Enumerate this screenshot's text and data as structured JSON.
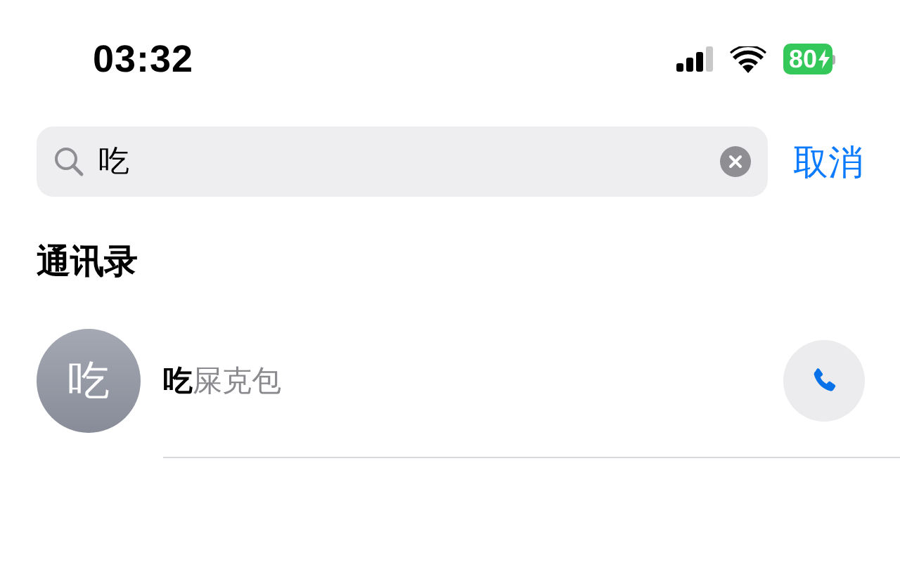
{
  "status_bar": {
    "time": "03:32",
    "battery": "80"
  },
  "search": {
    "value": "吃",
    "cancel": "取消"
  },
  "section": {
    "title": "通讯录"
  },
  "contacts": [
    {
      "initial": "吃",
      "match": "吃",
      "rest": "屎克包"
    }
  ]
}
